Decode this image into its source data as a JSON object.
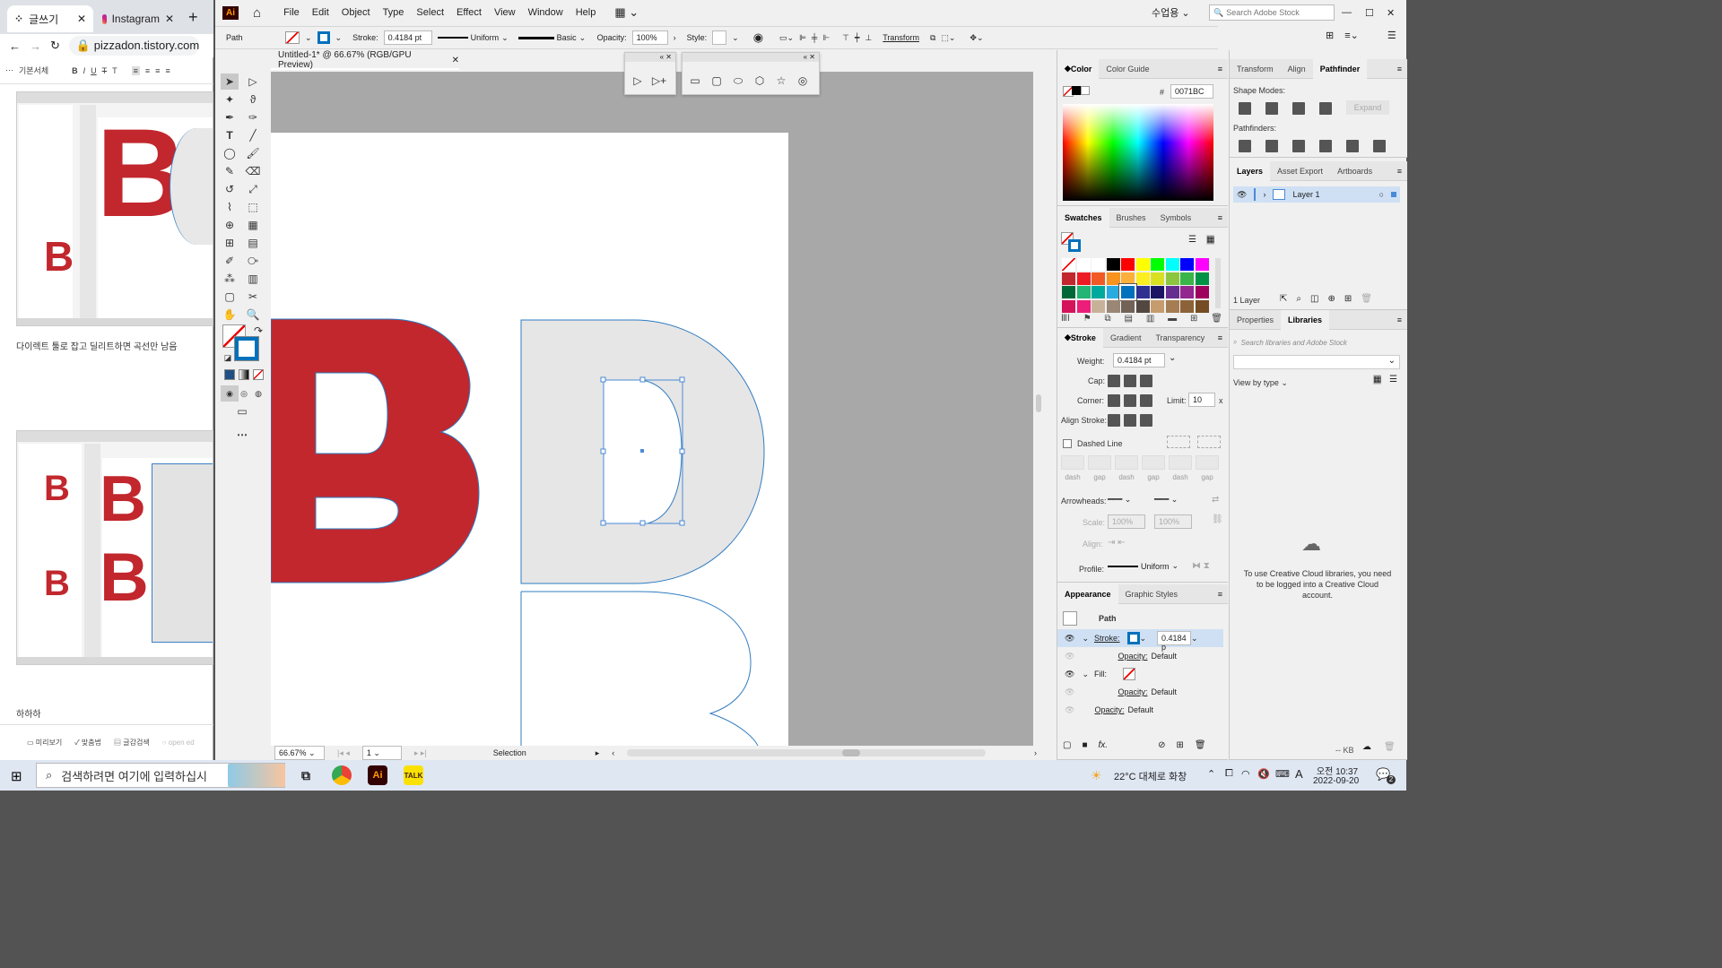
{
  "browser": {
    "tabs": [
      {
        "label": "글쓰기"
      },
      {
        "label": "Instagram"
      }
    ],
    "url": "pizzadon.tistory.com/m",
    "editor_font": "기본서체",
    "post_text1": "다이렉트 툴로 잡고 딜리트하면 곡선만 남음",
    "post_text2": "하하하",
    "footer": [
      "미리보기",
      "맞춤법",
      "글감검색",
      "open ed"
    ]
  },
  "ai": {
    "logo": "Ai",
    "menus": [
      "File",
      "Edit",
      "Object",
      "Type",
      "Select",
      "Effect",
      "View",
      "Window",
      "Help"
    ],
    "workspace": "수업용",
    "search_placeholder": "Search Adobe Stock",
    "control": {
      "object_type": "Path",
      "stroke_label": "Stroke:",
      "stroke_weight": "0.4184 pt",
      "profile": "Uniform",
      "brush": "Basic",
      "opacity_label": "Opacity:",
      "opacity": "100%",
      "style_label": "Style:",
      "transform_label": "Transform"
    },
    "document_tab": "Untitled-1* @ 66.67% (RGB/GPU Preview)",
    "status": {
      "zoom": "66.67%",
      "artboard": "1",
      "tool": "Selection"
    },
    "color_panel": {
      "tabs": [
        "Color",
        "Color Guide"
      ],
      "hex_prefix": "#",
      "hex": "0071BC"
    },
    "swatches_panel": {
      "tabs": [
        "Swatches",
        "Brushes",
        "Symbols"
      ]
    },
    "stroke_panel": {
      "tabs": [
        "Stroke",
        "Gradient",
        "Transparency"
      ],
      "weight_label": "Weight:",
      "weight": "0.4184 pt",
      "cap_label": "Cap:",
      "corner_label": "Corner:",
      "limit_label": "Limit:",
      "limit": "10",
      "limit_unit": "x",
      "align_label": "Align Stroke:",
      "dashed_label": "Dashed Line",
      "dash_labels": [
        "dash",
        "gap",
        "dash",
        "gap",
        "dash",
        "gap"
      ],
      "arrowheads_label": "Arrowheads:",
      "scale_label": "Scale:",
      "scale1": "100%",
      "scale2": "100%",
      "arrow_align_label": "Align:",
      "profile_label": "Profile:",
      "profile": "Uniform"
    },
    "appearance_panel": {
      "tabs": [
        "Appearance",
        "Graphic Styles"
      ],
      "title": "Path",
      "stroke_label": "Stroke:",
      "stroke_value": "0.4184 p",
      "opacity_label": "Opacity:",
      "opacity_value": "Default",
      "fill_label": "Fill:",
      "fill_opacity_label": "Opacity:",
      "fill_opacity_value": "Default",
      "obj_opacity_label": "Opacity:",
      "obj_opacity_value": "Default",
      "fx": "fx."
    },
    "transform_panel": {
      "tabs": [
        "Transform",
        "Align",
        "Pathfinder"
      ],
      "shape_modes": "Shape Modes:",
      "pathfinders": "Pathfinders:",
      "expand": "Expand"
    },
    "layers_panel": {
      "tabs": [
        "Layers",
        "Asset Export",
        "Artboards"
      ],
      "layer_name": "Layer 1",
      "count": "1 Layer"
    },
    "libraries_panel": {
      "tabs": [
        "Properties",
        "Libraries"
      ],
      "search_placeholder": "Search libraries and Adobe Stock",
      "view_by": "View by type",
      "message": "To use Creative Cloud libraries, you need to be logged into a Creative Cloud account.",
      "kb": "-- KB"
    },
    "artwork": {
      "letter1": "B",
      "letter1_color": "#c1272d",
      "outline_color": "#2f7cc1"
    }
  },
  "taskbar": {
    "search_placeholder": "검색하려면 여기에 입력하십시",
    "weather": "22°C 대체로 화창",
    "ime": "A",
    "time_period": "오전 10:37",
    "date": "2022-09-20",
    "notifications": "2"
  }
}
